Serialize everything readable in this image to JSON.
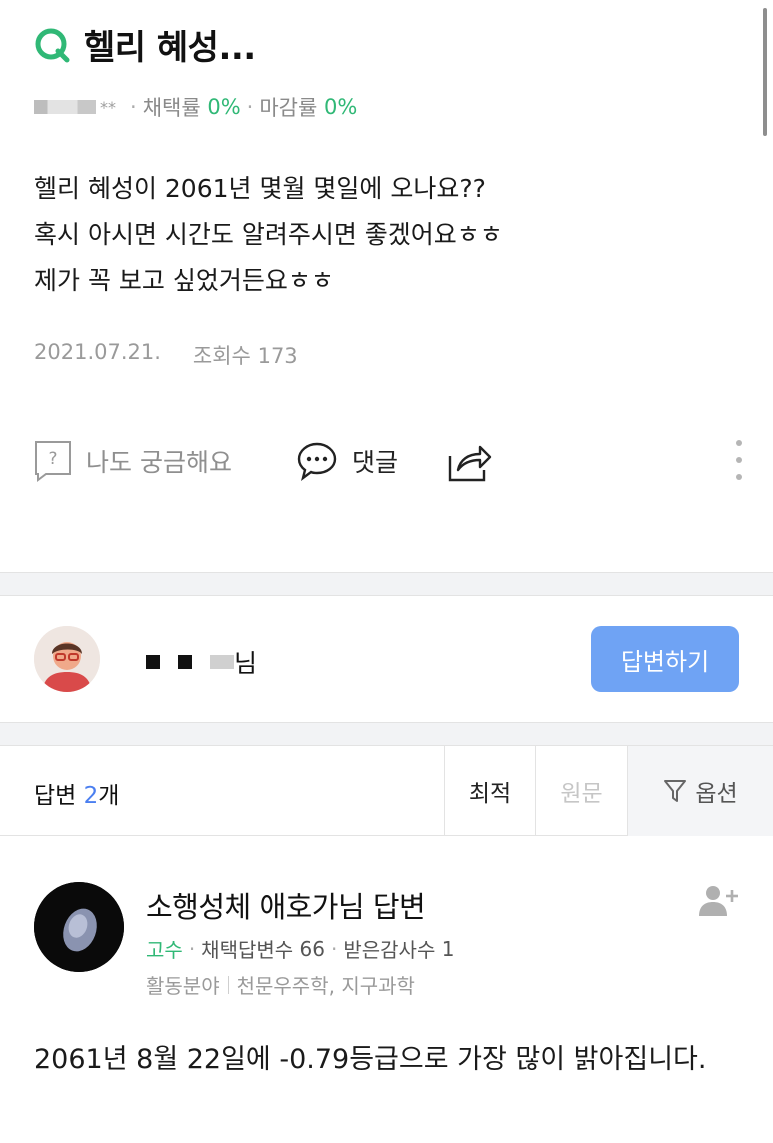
{
  "question": {
    "title": "헬리 혜성...",
    "asker_masked": "**",
    "adoption_rate_label": "채택률",
    "adoption_rate": "0%",
    "close_rate_label": "마감률",
    "close_rate": "0%",
    "body_lines": [
      "헬리 혜성이 2061년 몇월 몇일에 오나요??",
      "혹시 아시면 시간도 알려주시면 좋겠어요ㅎㅎ",
      "제가 꼭 보고 싶었거든요ㅎㅎ"
    ],
    "date": "2021.07.21.",
    "views_label": "조회수",
    "views": "173"
  },
  "actions": {
    "curious_label": "나도 궁금해요",
    "comment_label": "댓글"
  },
  "answer_prompt": {
    "user_suffix": "님",
    "answer_button": "답변하기"
  },
  "tabs": {
    "answer_label": "답변",
    "answer_count": "2",
    "answer_unit": "개",
    "best": "최적",
    "original": "원문",
    "option": "옵션"
  },
  "answer": {
    "title": "소행성체 애호가님 답변",
    "grade": "고수",
    "adopted_label": "채택답변수",
    "adopted_count": "66",
    "thanks_label": "받은감사수",
    "thanks_count": "1",
    "field_label": "활동분야",
    "fields": "천문우주학, 지구과학",
    "body": "2061년 8월 22일에 -0.79등급으로 가장 많이 밝아집니다."
  },
  "colors": {
    "brand_green": "#30b876",
    "answer_button_blue": "#6fa3f4",
    "count_blue": "#4b7ff0"
  },
  "icons": [
    "q-logo-icon",
    "question-mark-box-icon",
    "speech-bubble-icon",
    "share-icon",
    "more-vertical-icon",
    "filter-funnel-icon",
    "add-user-icon"
  ]
}
